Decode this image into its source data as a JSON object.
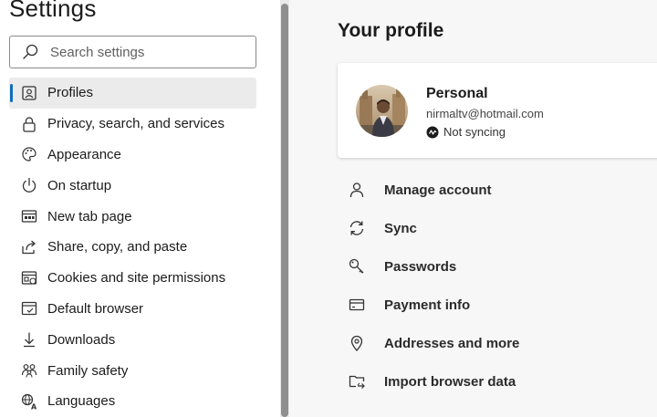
{
  "sidebar": {
    "title": "Settings",
    "search": {
      "placeholder": "Search settings",
      "value": ""
    },
    "items": [
      {
        "label": "Profiles",
        "icon": "profile-card-icon",
        "active": true
      },
      {
        "label": "Privacy, search, and services",
        "icon": "lock-icon"
      },
      {
        "label": "Appearance",
        "icon": "palette-icon"
      },
      {
        "label": "On startup",
        "icon": "power-icon"
      },
      {
        "label": "New tab page",
        "icon": "new-tab-icon"
      },
      {
        "label": "Share, copy, and paste",
        "icon": "share-icon"
      },
      {
        "label": "Cookies and site permissions",
        "icon": "cookies-icon"
      },
      {
        "label": "Default browser",
        "icon": "browser-icon"
      },
      {
        "label": "Downloads",
        "icon": "download-icon"
      },
      {
        "label": "Family safety",
        "icon": "family-icon"
      },
      {
        "label": "Languages",
        "icon": "languages-icon"
      }
    ]
  },
  "main": {
    "title": "Your profile",
    "profile": {
      "name": "Personal",
      "email": "nirmaltv@hotmail.com",
      "sync_status": "Not syncing"
    },
    "menu": [
      {
        "label": "Manage account",
        "icon": "person-icon"
      },
      {
        "label": "Sync",
        "icon": "sync-icon"
      },
      {
        "label": "Passwords",
        "icon": "key-icon"
      },
      {
        "label": "Payment info",
        "icon": "credit-card-icon"
      },
      {
        "label": "Addresses and more",
        "icon": "location-pin-icon"
      },
      {
        "label": "Import browser data",
        "icon": "import-folder-icon"
      }
    ]
  },
  "colors": {
    "accent": "#0f6cbd",
    "active_bg": "#ebebeb",
    "page_bg": "#f7f7f7"
  }
}
